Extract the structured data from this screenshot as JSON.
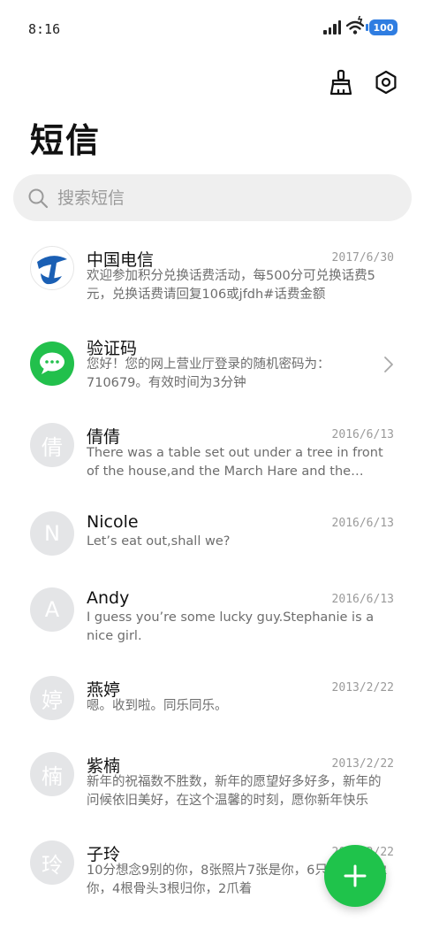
{
  "status_bar": {
    "time": "8:16",
    "battery": "100"
  },
  "page_title": "短信",
  "search": {
    "placeholder": "搜索短信"
  },
  "conversations": [
    {
      "name": "中国电信",
      "date": "2017/6/30",
      "preview": "欢迎参加积分兑换话费活动，每500分可兑换话费5元，兑换话费请回复106或jfdh#话费金额",
      "avatar_type": "telecom-logo"
    },
    {
      "name": "验证码",
      "date": "",
      "preview": "您好！您的网上营业厅登录的随机密码为：710679。有效时间为3分钟",
      "avatar_type": "chat-bubble",
      "has_chevron": true
    },
    {
      "name": "倩倩",
      "date": "2016/6/13",
      "preview": "There was a table set out under a tree in front of the house,and the March Hare and the Hatter were having tea at it",
      "avatar_letter": "倩"
    },
    {
      "name": "Nicole",
      "date": "2016/6/13",
      "preview": "Let’s eat out,shall we?",
      "avatar_letter": "N"
    },
    {
      "name": "Andy",
      "date": "2016/6/13",
      "preview": "I guess you’re some lucky guy.Stephanie is a nice girl.",
      "avatar_letter": "A"
    },
    {
      "name": "燕婷",
      "date": "2013/2/22",
      "preview": "嗯。收到啦。同乐同乐。",
      "avatar_letter": "婷"
    },
    {
      "name": "紫楠",
      "date": "2013/2/22",
      "preview": "新年的祝福数不胜数，新年的愿望好多好多，新年的问候依旧美好，在这个温馨的时刻，愿你新年快乐",
      "avatar_letter": "楠"
    },
    {
      "name": "子玲",
      "date": "2013/2/22",
      "preview": "10分想念9别的你，8张照片7张是你，6只小狗5只像你，4根骨头3根归你，2爪着",
      "avatar_letter": "玲"
    }
  ],
  "colors": {
    "accent": "#1fc34b",
    "telecom_blue": "#1a5fb4",
    "battery": "#2f7de1"
  },
  "icons": {
    "clean": "broom-icon",
    "settings": "settings-icon",
    "search": "search-icon",
    "compose": "plus-icon"
  }
}
